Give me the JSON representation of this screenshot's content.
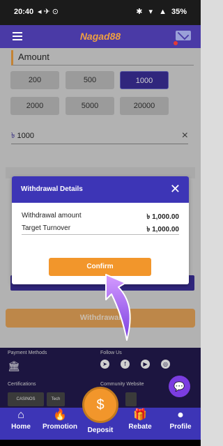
{
  "status": {
    "time": "20:40",
    "battery": "35%"
  },
  "header": {
    "logo": "Nagad88"
  },
  "amount": {
    "title": "Amount",
    "chips": [
      "200",
      "500",
      "1000",
      "2000",
      "5000",
      "20000"
    ],
    "selected": "1000",
    "currency": "৳",
    "input_value": "1000",
    "clear_icon": "close-icon"
  },
  "bg_button": "Withdrawal",
  "modal": {
    "title": "Withdrawal Details",
    "rows": [
      {
        "label": "Withdrawal amount",
        "value": "৳ 1,000.00"
      },
      {
        "label": "Target Turnover",
        "value": "৳ 1,000.00"
      }
    ],
    "confirm": "Confirm"
  },
  "footer": {
    "payment_methods": "Payment Methods",
    "follow_us": "Follow Us",
    "certifications": "Certifications",
    "community_website": "Community Website",
    "cert1": "CASINOS ANALYZER",
    "cert2": "Tech"
  },
  "nav": {
    "home": "Home",
    "promotion": "Promotion",
    "deposit": "Deposit",
    "rebate": "Rebate",
    "profile": "Profile"
  },
  "colors": {
    "primary": "#3d35b6",
    "accent": "#f2962b"
  }
}
